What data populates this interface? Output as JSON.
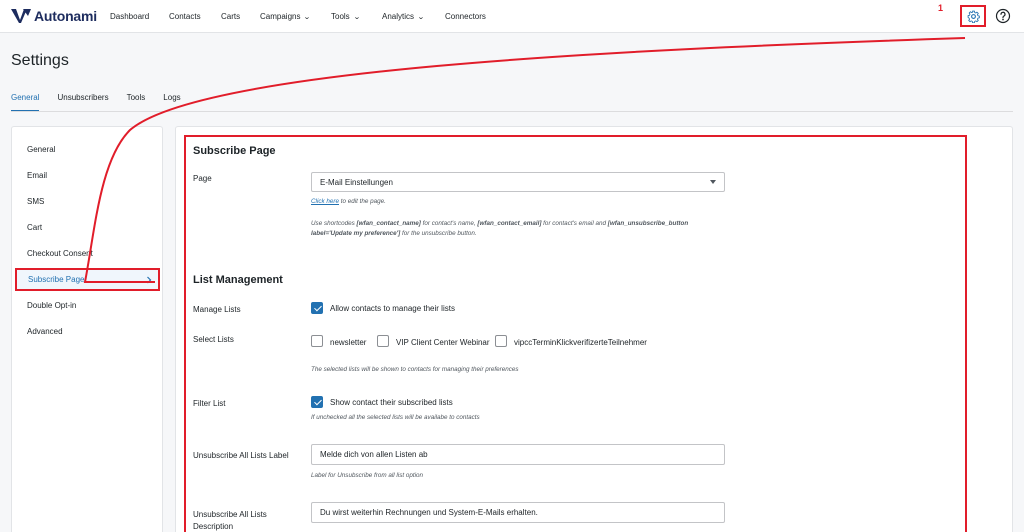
{
  "brand": {
    "name": "Autonami"
  },
  "nav": [
    {
      "label": "Dashboard",
      "dropdown": false
    },
    {
      "label": "Contacts",
      "dropdown": false
    },
    {
      "label": "Carts",
      "dropdown": false
    },
    {
      "label": "Campaigns",
      "dropdown": true
    },
    {
      "label": "Tools",
      "dropdown": true
    },
    {
      "label": "Analytics",
      "dropdown": true
    },
    {
      "label": "Connectors",
      "dropdown": false
    }
  ],
  "annotation": {
    "number": "1",
    "color": "#e11d2a"
  },
  "page": {
    "title": "Settings"
  },
  "tabs": [
    {
      "label": "General",
      "active": true
    },
    {
      "label": "Unsubscribers",
      "active": false
    },
    {
      "label": "Tools",
      "active": false
    },
    {
      "label": "Logs",
      "active": false
    }
  ],
  "sidebar": {
    "items": [
      {
        "label": "General"
      },
      {
        "label": "Email"
      },
      {
        "label": "SMS"
      },
      {
        "label": "Cart"
      },
      {
        "label": "Checkout Consent"
      },
      {
        "label": "Subscribe Page",
        "active": true
      },
      {
        "label": "Double Opt-in"
      },
      {
        "label": "Advanced"
      }
    ]
  },
  "subscribe_page": {
    "title": "Subscribe Page",
    "page_label": "Page",
    "page_selected": "E-Mail Einstellungen",
    "edit_link": "Click here",
    "edit_text": " to edit the page.",
    "shortcode_hint": {
      "p1": "Use shortcodes ",
      "c1": "[wfan_contact_name]",
      "p2": " for contact's name, ",
      "c2": "[wfan_contact_email]",
      "p3": " for contact's email and ",
      "c3": "[wfan_unsubscribe_button",
      "c4": "label='Update my preference']",
      "p4": " for the unsubscribe button."
    }
  },
  "list_management": {
    "title": "List Management",
    "manage_lists_label": "Manage Lists",
    "manage_lists_checkbox": "Allow contacts to manage their lists",
    "select_lists_label": "Select Lists",
    "lists": [
      {
        "label": "newsletter",
        "checked": false
      },
      {
        "label": "VIP Client Center Webinar",
        "checked": false
      },
      {
        "label": "vipccTerminKlickverifizerteTeilnehmer",
        "checked": false
      }
    ],
    "select_lists_hint": "The selected lists will be shown to contacts for managing their preferences",
    "filter_list_label": "Filter List",
    "filter_list_checkbox": "Show contact their subscribed lists",
    "filter_list_hint": "If unchecked all the selected lists will be availabe to contacts",
    "unsub_all_label": "Unsubscribe All Lists Label",
    "unsub_all_value": "Melde dich von allen Listen ab",
    "unsub_all_hint": "Label for Unsubscribe from all list option",
    "unsub_desc_label_1": "Unsubscribe All Lists",
    "unsub_desc_label_2": "Description",
    "unsub_desc_value": "Du wirst weiterhin Rechnungen und System-E-Mails erhalten."
  },
  "colors": {
    "accent": "#2271b1",
    "highlight": "#e11d2a",
    "brand": "#1d2c5e"
  }
}
